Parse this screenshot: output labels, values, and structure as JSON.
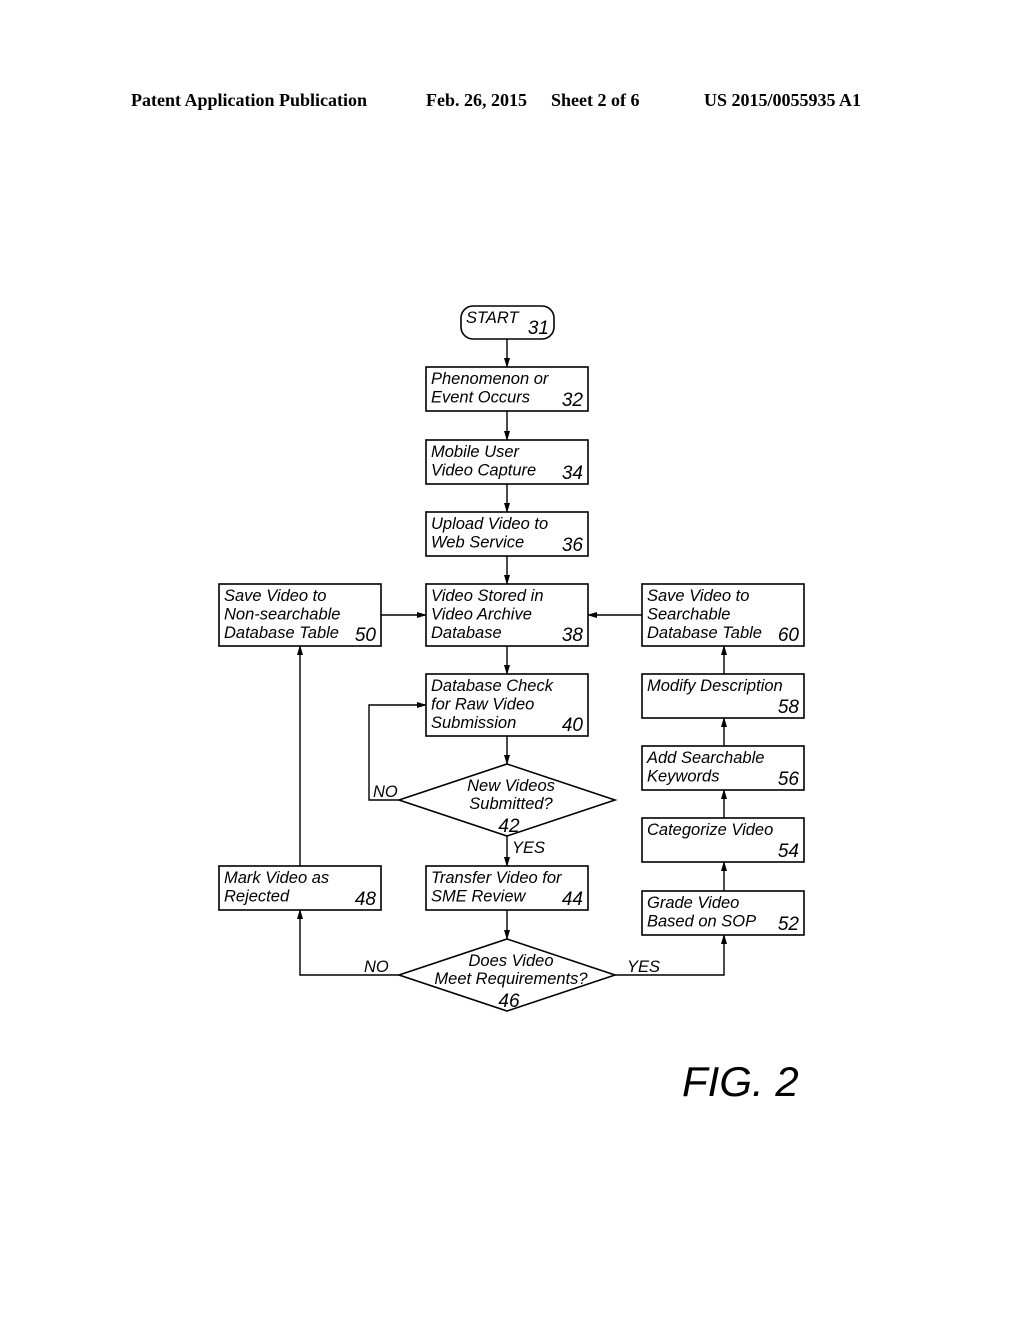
{
  "header": {
    "publication": "Patent Application Publication",
    "date": "Feb. 26, 2015",
    "sheet": "Sheet 2 of 6",
    "number": "US 2015/0055935 A1"
  },
  "figure_label": "FIG. 2",
  "nodes": {
    "start": {
      "lines": [
        "START"
      ],
      "ref": "31",
      "shape": "terminal"
    },
    "n32": {
      "lines": [
        "Phenomenon or",
        "Event Occurs"
      ],
      "ref": "32",
      "shape": "process"
    },
    "n34": {
      "lines": [
        "Mobile User",
        "Video Capture"
      ],
      "ref": "34",
      "shape": "process"
    },
    "n36": {
      "lines": [
        "Upload Video to",
        "Web Service"
      ],
      "ref": "36",
      "shape": "process"
    },
    "n38": {
      "lines": [
        "Video Stored in",
        "Video Archive",
        "Database"
      ],
      "ref": "38",
      "shape": "process"
    },
    "n40": {
      "lines": [
        "Database Check",
        "for Raw Video",
        "Submission"
      ],
      "ref": "40",
      "shape": "process"
    },
    "n42": {
      "lines": [
        "New Videos",
        "Submitted?"
      ],
      "ref": "42",
      "shape": "decision"
    },
    "n44": {
      "lines": [
        "Transfer Video for",
        "SME Review"
      ],
      "ref": "44",
      "shape": "process"
    },
    "n46": {
      "lines": [
        "Does Video",
        "Meet Requirements?"
      ],
      "ref": "46",
      "shape": "decision"
    },
    "n48": {
      "lines": [
        "Mark Video as",
        "Rejected"
      ],
      "ref": "48",
      "shape": "process"
    },
    "n50": {
      "lines": [
        "Save Video to",
        "Non-searchable",
        "Database Table"
      ],
      "ref": "50",
      "shape": "process"
    },
    "n52": {
      "lines": [
        "Grade Video",
        "Based on SOP"
      ],
      "ref": "52",
      "shape": "process"
    },
    "n54": {
      "lines": [
        "Categorize Video"
      ],
      "ref": "54",
      "shape": "process"
    },
    "n56": {
      "lines": [
        "Add Searchable",
        "Keywords"
      ],
      "ref": "56",
      "shape": "process"
    },
    "n58": {
      "lines": [
        "Modify Description"
      ],
      "ref": "58",
      "shape": "process"
    },
    "n60": {
      "lines": [
        "Save Video to",
        "Searchable",
        "Database Table"
      ],
      "ref": "60",
      "shape": "process"
    }
  },
  "edges": [
    {
      "from": "start",
      "to": "n32"
    },
    {
      "from": "n32",
      "to": "n34"
    },
    {
      "from": "n34",
      "to": "n36"
    },
    {
      "from": "n36",
      "to": "n38"
    },
    {
      "from": "n38",
      "to": "n40"
    },
    {
      "from": "n40",
      "to": "n42"
    },
    {
      "from": "n42",
      "to": "n40",
      "label": "NO"
    },
    {
      "from": "n42",
      "to": "n44",
      "label": "YES"
    },
    {
      "from": "n44",
      "to": "n46"
    },
    {
      "from": "n46",
      "to": "n48",
      "label": "NO"
    },
    {
      "from": "n48",
      "to": "n50"
    },
    {
      "from": "n50",
      "to": "n38"
    },
    {
      "from": "n46",
      "to": "n52",
      "label": "YES"
    },
    {
      "from": "n52",
      "to": "n54"
    },
    {
      "from": "n54",
      "to": "n56"
    },
    {
      "from": "n56",
      "to": "n58"
    },
    {
      "from": "n58",
      "to": "n60"
    },
    {
      "from": "n60",
      "to": "n38"
    }
  ],
  "edge_labels": {
    "n42_no": "NO",
    "n42_yes": "YES",
    "n46_no": "NO",
    "n46_yes": "YES"
  }
}
